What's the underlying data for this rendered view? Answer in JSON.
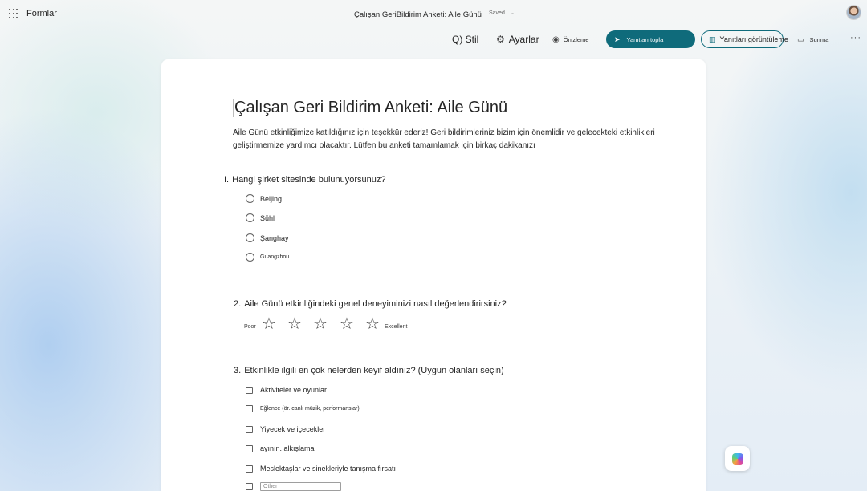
{
  "header": {
    "app_name": "Formlar",
    "doc_title": "Çalışan GeriBildirim Anketi: Aile Günü",
    "saved": "Saved",
    "chevron": "⌄"
  },
  "toolbar": {
    "style_label": "Q) Stil",
    "settings_label": "Ayarlar",
    "preview_label": "Önizleme",
    "collect_label": "Yanıtları topla",
    "view_responses_label": "Yanıtları görüntüleme",
    "present_label": "Sunma",
    "more_label": "···"
  },
  "form": {
    "title": "Çalışan Geri Bildirim Anketi: Aile Günü",
    "description": "Aile Günü etkinliğimize katıldığınız için teşekkür ederiz! Geri bildirimleriniz bizim için önemlidir ve gelecekteki etkinlikleri geliştirmemize yardımcı olacaktır. Lütfen bu anketi tamamlamak için birkaç dakikanızı",
    "questions": [
      {
        "number": "I.",
        "text": "Hangi şirket sitesinde bulunuyorsunuz?",
        "options": [
          "Beijing",
          "Sühl",
          "Şanghay",
          "Guangzhou"
        ]
      },
      {
        "number": "2.",
        "text": "Aile Günü etkinliğindeki genel deneyiminizi nasıl değerlendirirsiniz?",
        "low_label": "Poor",
        "high_label": "Excellent",
        "star_count": 5
      },
      {
        "number": "3.",
        "text": "Etkinlikle ilgili en çok nelerden keyif aldınız? (Uygun olanları seçin)",
        "options": [
          "Aktiviteler ve oyunlar",
          "Eğlence (ör. canlı müzik, performanslar)",
          "Yiyecek ve içecekler",
          "ayının. alkışlama",
          "Meslektaşlar ve sinekleriyle tanışma fırsatı"
        ],
        "other_placeholder": "Other"
      }
    ]
  },
  "icons": {
    "gear": "⚙",
    "eye": "◉",
    "send": "➤",
    "chart": "▥",
    "monitor": "▭",
    "star": "☆"
  }
}
